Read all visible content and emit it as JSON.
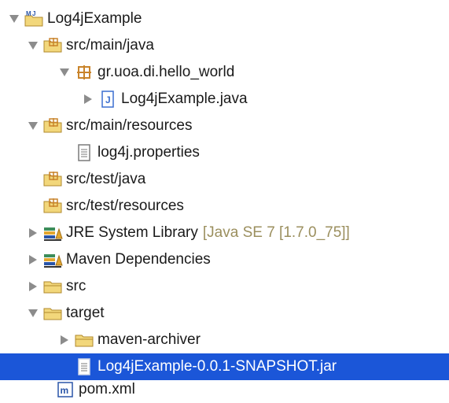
{
  "tree": {
    "rows": [
      {
        "label": "Log4jExample",
        "icon": "java-project-icon",
        "expanded": true
      },
      {
        "label": "src/main/java",
        "icon": "source-folder-icon",
        "expanded": true
      },
      {
        "label": "gr.uoa.di.hello_world",
        "icon": "package-icon",
        "expanded": true
      },
      {
        "label": "Log4jExample.java",
        "icon": "java-file-icon",
        "expanded": false
      },
      {
        "label": "src/main/resources",
        "icon": "source-folder-icon",
        "expanded": true
      },
      {
        "label": "log4j.properties",
        "icon": "text-file-icon"
      },
      {
        "label": "src/test/java",
        "icon": "source-folder-icon"
      },
      {
        "label": "src/test/resources",
        "icon": "source-folder-icon"
      },
      {
        "label": "JRE System Library",
        "decoration": "[Java SE 7 [1.7.0_75]]",
        "icon": "library-icon",
        "expanded": false
      },
      {
        "label": "Maven Dependencies",
        "icon": "library-icon",
        "expanded": false
      },
      {
        "label": "src",
        "icon": "folder-icon",
        "expanded": false
      },
      {
        "label": "target",
        "icon": "folder-icon",
        "expanded": true
      },
      {
        "label": "maven-archiver",
        "icon": "folder-icon",
        "expanded": false
      },
      {
        "label": "Log4jExample-0.0.1-SNAPSHOT.jar",
        "icon": "jar-file-icon",
        "selected": true
      },
      {
        "label": "pom.xml",
        "icon": "maven-pom-icon"
      }
    ],
    "colors": {
      "selection": "#1b56d8",
      "decoration_text": "#9b8f5e",
      "folder": "#f2d77b",
      "package": "#c9842b",
      "java_file": "#3b6fd0",
      "maven": "#2a55a8"
    }
  }
}
